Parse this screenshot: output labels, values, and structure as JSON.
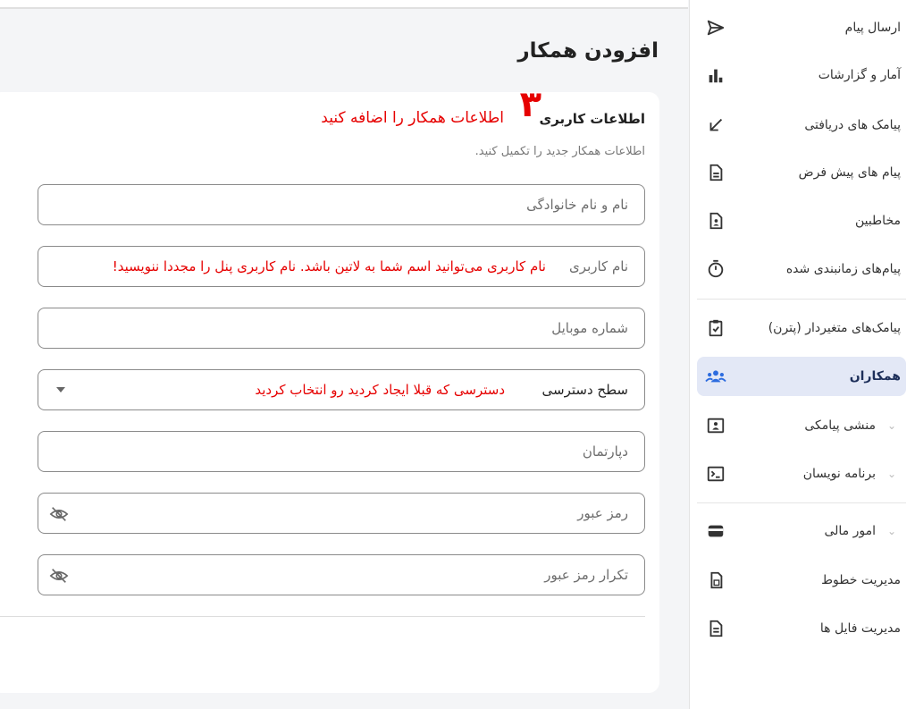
{
  "sidebar": {
    "items": [
      {
        "label": "ارسال پیام",
        "icon": "send-icon"
      },
      {
        "label": "آمار و گزارشات",
        "icon": "bar-chart-icon"
      },
      {
        "label": "پیامک های دریافتی",
        "icon": "arrow-down-left-icon"
      },
      {
        "label": "پیام های پیش فرض",
        "icon": "document-icon"
      },
      {
        "label": "مخاطبین",
        "icon": "contact-icon"
      },
      {
        "label": "پیام‌های زمانبندی شده",
        "icon": "timer-icon"
      },
      {
        "label": "پیامک‌های متغیردار (پترن)",
        "icon": "clipboard-check-icon"
      },
      {
        "label": "همکاران",
        "icon": "users-icon",
        "active": true
      },
      {
        "label": "منشی پیامکی",
        "icon": "id-card-icon",
        "expandable": true
      },
      {
        "label": "برنامه نویسان",
        "icon": "terminal-icon",
        "expandable": true
      },
      {
        "label": "امور مالی",
        "icon": "wallet-icon",
        "expandable": true
      },
      {
        "label": "مدیریت خطوط",
        "icon": "sim-card-icon"
      },
      {
        "label": "مدیریت فایل ها",
        "icon": "file-icon"
      }
    ]
  },
  "page": {
    "title": "افزودن همکار",
    "section_title": "اطلاعات کاربری",
    "section_desc": "اطلاعات همکار جدید را تکمیل کنید."
  },
  "annotations": {
    "step_number": "۳",
    "step_text": "اطلاعات همکار را اضافه کنید",
    "username_note": "نام کاربری می‌توانید اسم شما به لاتین باشد. نام کاربری پنل را مجددا ننویسید!",
    "access_note": "دسترسی که قبلا ایجاد کردید رو انتخاب کردید"
  },
  "form": {
    "fullname_placeholder": "نام و نام خانوادگی",
    "username_placeholder": "نام کاربری",
    "mobile_placeholder": "شماره موبایل",
    "access_value": "سطح دسترسی",
    "department_placeholder": "دپارتمان",
    "password_placeholder": "رمز عبور",
    "password_confirm_placeholder": "تکرار رمز عبور"
  },
  "colors": {
    "annotation": "#e60000",
    "active_bg": "#e3e8f6",
    "active_icon": "#2d6cdf"
  }
}
